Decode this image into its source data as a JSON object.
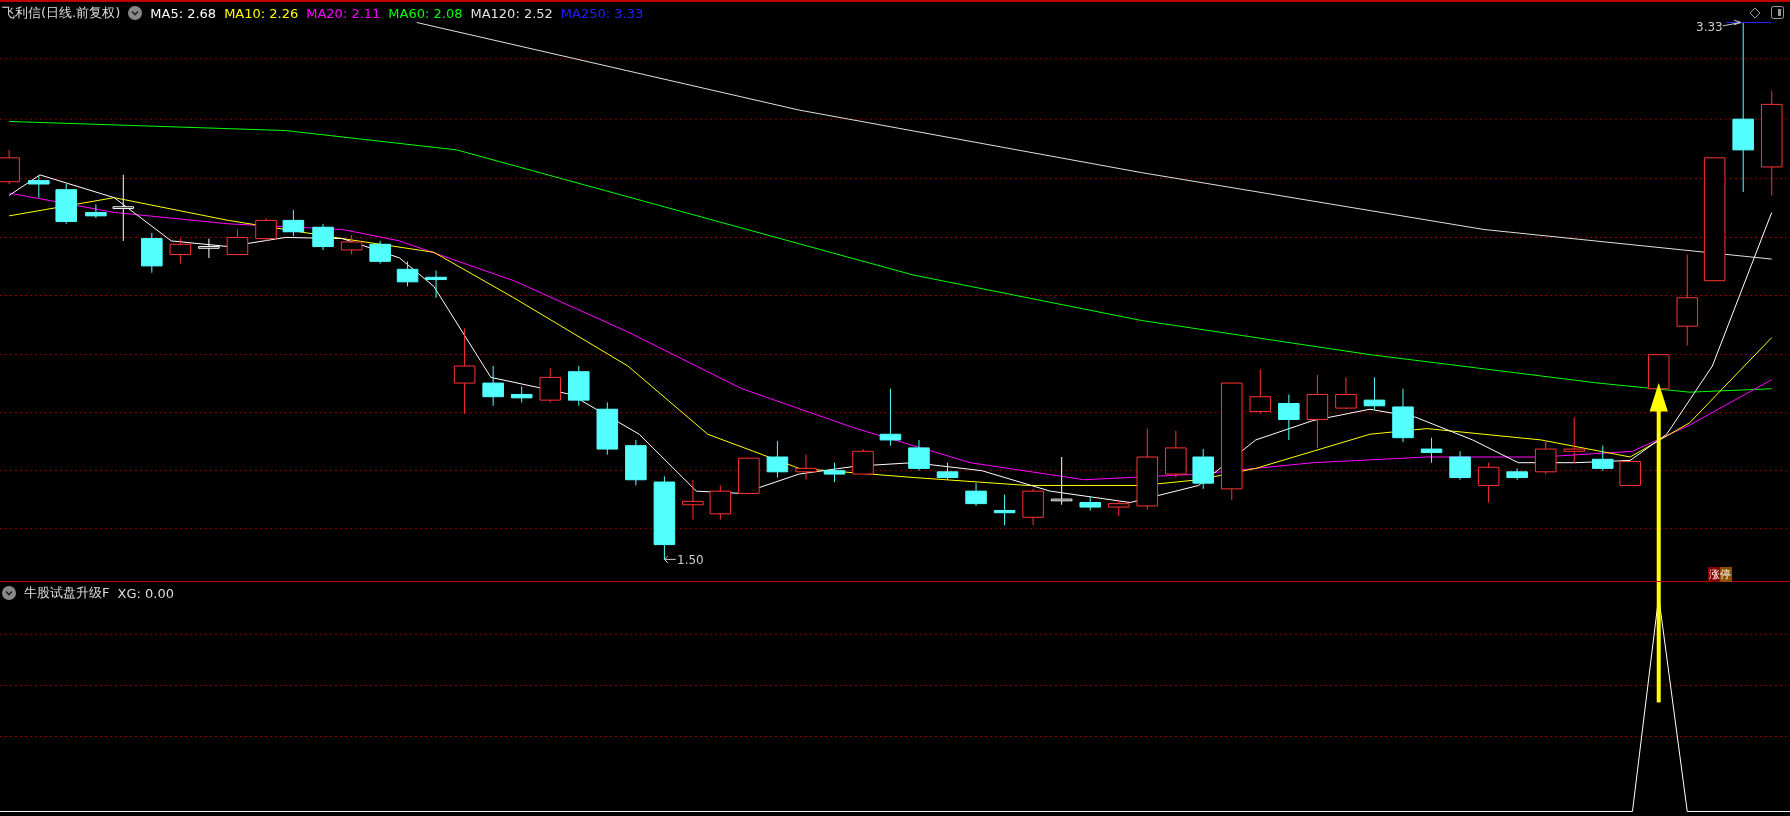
{
  "chart": {
    "title": "飞利信(日线.前复权)",
    "indicators": [
      {
        "label": "MA5: 2.68",
        "color": "#ffffff"
      },
      {
        "label": "MA10: 2.26",
        "color": "#ffff00"
      },
      {
        "label": "MA20: 2.11",
        "color": "#ff00ff"
      },
      {
        "label": "MA60: 2.08",
        "color": "#00ff00"
      },
      {
        "label": "MA120: 2.52",
        "color": "#e0e0e0"
      },
      {
        "label": "MA250: 3.33",
        "color": "#2020ff"
      }
    ],
    "high_label": "3.33",
    "low_label": "1.50",
    "limit_up_badge": "涨停"
  },
  "indicator_panel": {
    "name": "牛股试盘升级F",
    "value": "XG: 0.00"
  }
}
